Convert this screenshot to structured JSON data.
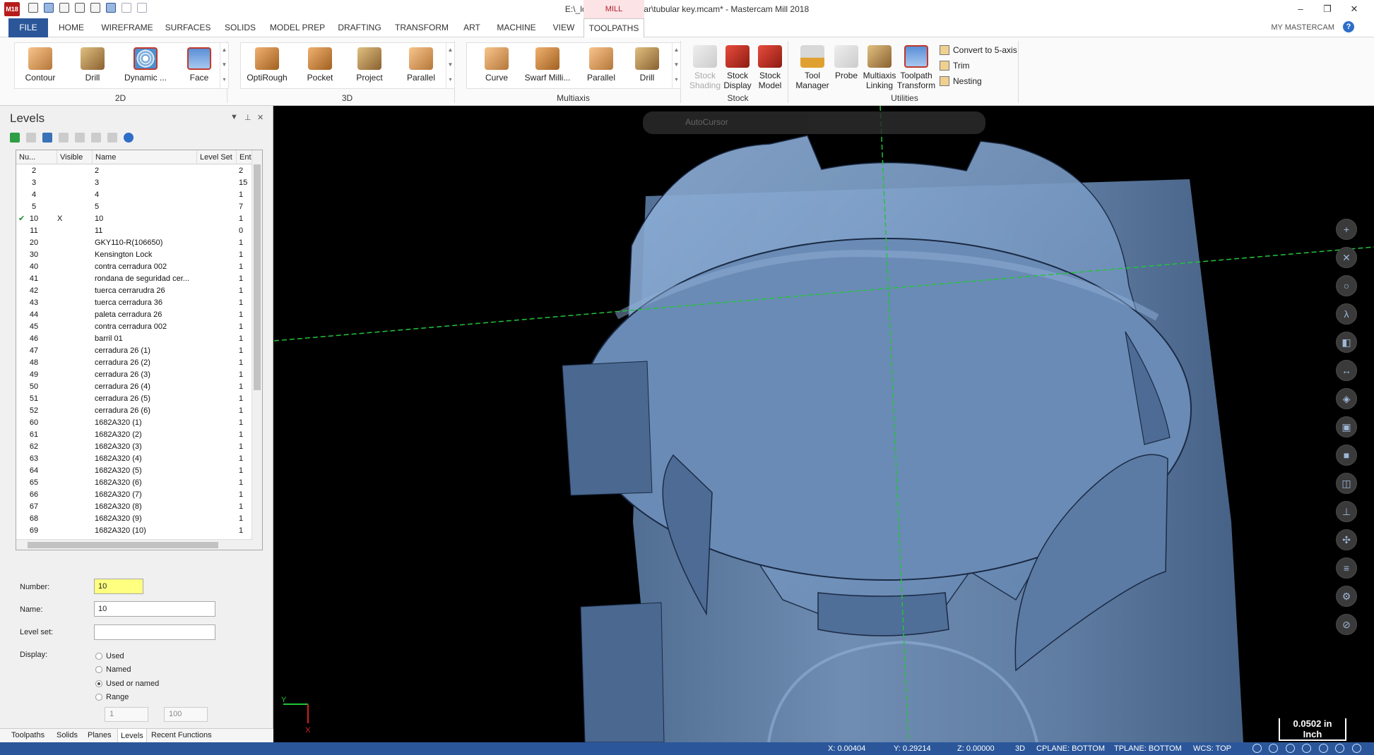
{
  "window": {
    "title": "E:\\_lock_stuff\\_Tubular\\tubular key.mcam* - Mastercam Mill 2018",
    "context_tab": "MILL",
    "logo": "M18",
    "controls": [
      "–",
      "❐",
      "✕"
    ]
  },
  "ribbon_tabs": [
    "FILE",
    "HOME",
    "WIREFRAME",
    "SURFACES",
    "SOLIDS",
    "MODEL PREP",
    "DRAFTING",
    "TRANSFORM",
    "ART",
    "MACHINE",
    "VIEW",
    "TOOLPATHS"
  ],
  "active_tab": "TOOLPATHS",
  "account_label": "MY MASTERCAM",
  "ribbon": {
    "groups": {
      "g2d": {
        "label": "2D",
        "buttons": [
          "Contour",
          "Drill",
          "Dynamic ...",
          "Face"
        ]
      },
      "g3d": {
        "label": "3D",
        "buttons": [
          "OptiRough",
          "Pocket",
          "Project",
          "Parallel"
        ]
      },
      "multiaxis": {
        "label": "Multiaxis",
        "buttons": [
          "Curve",
          "Swarf Milli...",
          "Parallel",
          "Drill"
        ]
      },
      "stock": {
        "label": "Stock",
        "buttons": [
          "Stock Shading",
          "Stock Display",
          "Stock Model"
        ]
      },
      "utilities": {
        "label": "Utilities",
        "buttons": [
          "Tool Manager",
          "Probe",
          "Multiaxis Linking",
          "Toolpath Transform"
        ],
        "small": [
          "Convert to 5-axis",
          "Trim",
          "Nesting"
        ]
      }
    }
  },
  "levels_panel": {
    "title": "Levels",
    "columns": [
      "Nu...",
      "Visible",
      "Name",
      "Level Set",
      "Entit"
    ],
    "rows": [
      {
        "num": "2",
        "visible": "",
        "name": "2",
        "entities": "2"
      },
      {
        "num": "3",
        "visible": "",
        "name": "3",
        "entities": "15"
      },
      {
        "num": "4",
        "visible": "",
        "name": "4",
        "entities": "1"
      },
      {
        "num": "5",
        "visible": "",
        "name": "5",
        "entities": "7"
      },
      {
        "num": "10",
        "visible": "X",
        "name": "10",
        "entities": "1",
        "active": true
      },
      {
        "num": "11",
        "visible": "",
        "name": "11",
        "entities": "0"
      },
      {
        "num": "20",
        "visible": "",
        "name": "GKY110-R(106650)",
        "entities": "1"
      },
      {
        "num": "30",
        "visible": "",
        "name": "Kensington Lock",
        "entities": "1"
      },
      {
        "num": "40",
        "visible": "",
        "name": "contra cerradura 002",
        "entities": "1"
      },
      {
        "num": "41",
        "visible": "",
        "name": "rondana de seguridad cer...",
        "entities": "1"
      },
      {
        "num": "42",
        "visible": "",
        "name": "tuerca cerrarudra 26",
        "entities": "1"
      },
      {
        "num": "43",
        "visible": "",
        "name": "tuerca cerradura 36",
        "entities": "1"
      },
      {
        "num": "44",
        "visible": "",
        "name": "paleta cerradura 26",
        "entities": "1"
      },
      {
        "num": "45",
        "visible": "",
        "name": "contra cerradura 002",
        "entities": "1"
      },
      {
        "num": "46",
        "visible": "",
        "name": "barril 01",
        "entities": "1"
      },
      {
        "num": "47",
        "visible": "",
        "name": "cerradura 26 (1)",
        "entities": "1"
      },
      {
        "num": "48",
        "visible": "",
        "name": "cerradura 26 (2)",
        "entities": "1"
      },
      {
        "num": "49",
        "visible": "",
        "name": "cerradura 26 (3)",
        "entities": "1"
      },
      {
        "num": "50",
        "visible": "",
        "name": "cerradura 26 (4)",
        "entities": "1"
      },
      {
        "num": "51",
        "visible": "",
        "name": "cerradura 26 (5)",
        "entities": "1"
      },
      {
        "num": "52",
        "visible": "",
        "name": "cerradura 26 (6)",
        "entities": "1"
      },
      {
        "num": "60",
        "visible": "",
        "name": "1682A320 (1)",
        "entities": "1"
      },
      {
        "num": "61",
        "visible": "",
        "name": "1682A320 (2)",
        "entities": "1"
      },
      {
        "num": "62",
        "visible": "",
        "name": "1682A320 (3)",
        "entities": "1"
      },
      {
        "num": "63",
        "visible": "",
        "name": "1682A320 (4)",
        "entities": "1"
      },
      {
        "num": "64",
        "visible": "",
        "name": "1682A320 (5)",
        "entities": "1"
      },
      {
        "num": "65",
        "visible": "",
        "name": "1682A320 (6)",
        "entities": "1"
      },
      {
        "num": "66",
        "visible": "",
        "name": "1682A320 (7)",
        "entities": "1"
      },
      {
        "num": "67",
        "visible": "",
        "name": "1682A320 (8)",
        "entities": "1"
      },
      {
        "num": "68",
        "visible": "",
        "name": "1682A320 (9)",
        "entities": "1"
      },
      {
        "num": "69",
        "visible": "",
        "name": "1682A320 (10)",
        "entities": "1"
      }
    ],
    "form": {
      "number_label": "Number:",
      "number_value": "10",
      "name_label": "Name:",
      "name_value": "10",
      "levelset_label": "Level set:",
      "levelset_value": "",
      "display_label": "Display:",
      "options": [
        "Used",
        "Named",
        "Used or named",
        "Range"
      ],
      "selected_option": "Used or named",
      "range_from": "1",
      "range_to": "100"
    },
    "bottom_tabs": [
      "Toolpaths",
      "Solids",
      "Planes",
      "Levels",
      "Recent Functions"
    ],
    "active_bottom_tab": "Levels"
  },
  "viewport": {
    "cursor_bar_label": "AutoCursor",
    "scale_value": "0.0502 in",
    "scale_unit": "Inch",
    "triad": {
      "y": "Y",
      "x": "X"
    }
  },
  "status_bar": {
    "x": "X:  0.00404",
    "y": "Y:  0.29214",
    "z": "Z:  0.00000",
    "mode": "3D",
    "cplane": "CPLANE: BOTTOM",
    "tplane": "TPLANE: BOTTOM",
    "wcs": "WCS: TOP"
  },
  "colors": {
    "file_tab": "#2b579a",
    "statusbar": "#2b579a",
    "solid_fill": "#6b8cb4",
    "crosshair": "#22c43a"
  }
}
